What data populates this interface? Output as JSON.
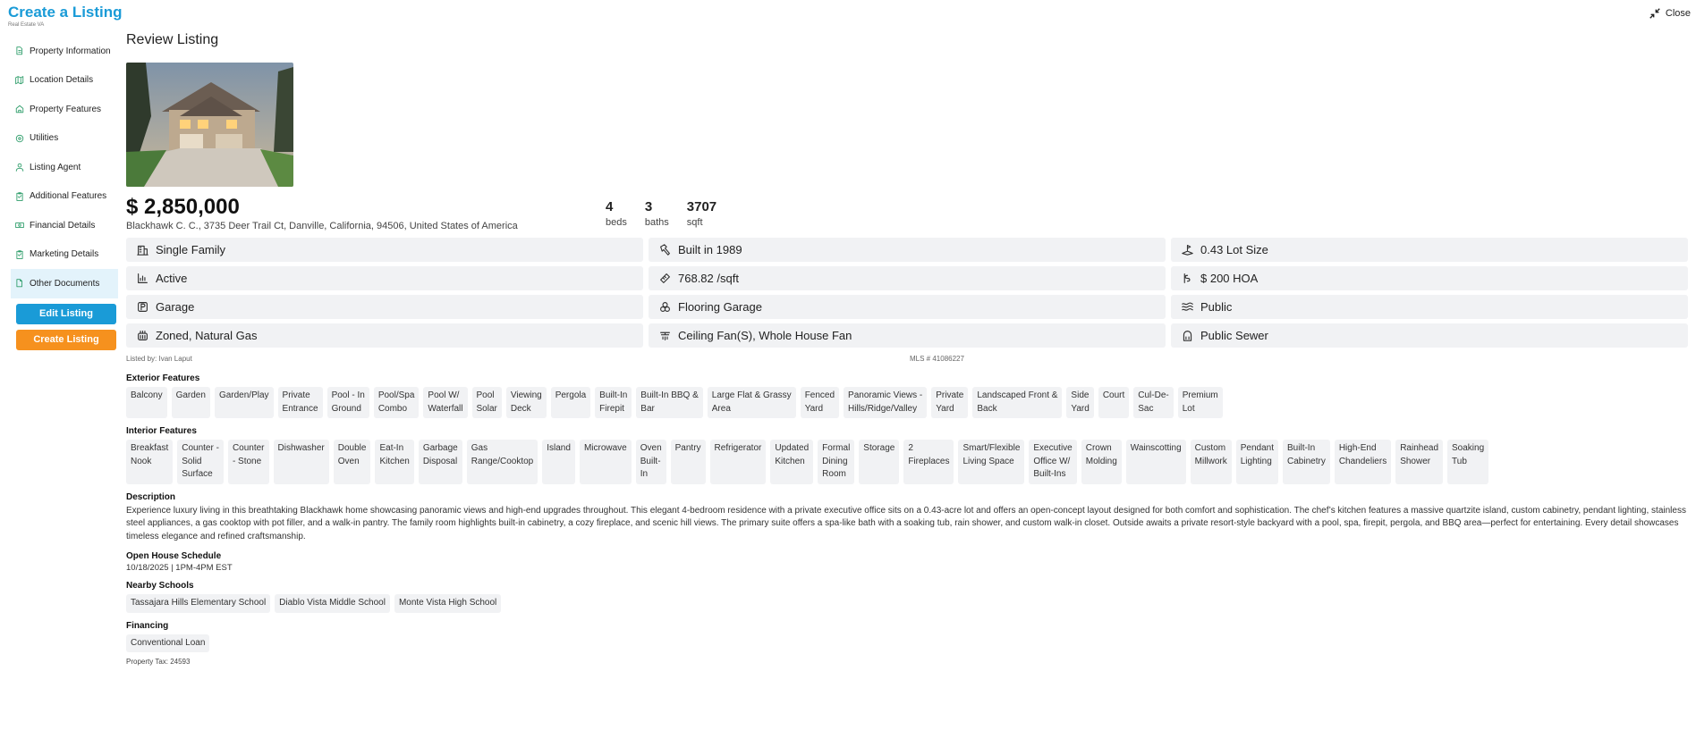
{
  "header": {
    "title": "Create a Listing",
    "subtitle": "Real Estate VA",
    "close_label": "Close"
  },
  "sidebar": {
    "items": [
      {
        "label": "Property Information",
        "icon": "document-icon"
      },
      {
        "label": "Location Details",
        "icon": "map-icon"
      },
      {
        "label": "Property Features",
        "icon": "home-icon"
      },
      {
        "label": "Utilities",
        "icon": "utility-icon"
      },
      {
        "label": "Listing Agent",
        "icon": "user-icon"
      },
      {
        "label": "Additional Features",
        "icon": "clipboard-icon"
      },
      {
        "label": "Financial Details",
        "icon": "money-icon"
      },
      {
        "label": "Marketing Details",
        "icon": "clipboard-icon"
      },
      {
        "label": "Other Documents",
        "icon": "file-icon"
      }
    ],
    "active_index": 8,
    "edit_label": "Edit Listing",
    "create_label": "Create Listing"
  },
  "review": {
    "title": "Review Listing",
    "price": "$ 2,850,000",
    "address": "Blackhawk C. C., 3735 Deer Trail Ct, Danville, California, 94506, United States of America",
    "stats": [
      {
        "num": "4",
        "label": "beds"
      },
      {
        "num": "3",
        "label": "baths"
      },
      {
        "num": "3707",
        "label": "sqft"
      }
    ],
    "facts": [
      {
        "text": "Single Family",
        "icon": "building-icon"
      },
      {
        "text": "Built in 1989",
        "icon": "hammer-icon"
      },
      {
        "text": "0.43 Lot Size",
        "icon": "land-icon"
      },
      {
        "text": "Active",
        "icon": "chart-icon"
      },
      {
        "text": "768.82 /sqft",
        "icon": "ruler-icon"
      },
      {
        "text": "$ 200 HOA",
        "icon": "hoa-icon"
      },
      {
        "text": "Garage",
        "icon": "parking-icon"
      },
      {
        "text": "Flooring Garage",
        "icon": "flooring-icon"
      },
      {
        "text": "Public",
        "icon": "water-icon"
      },
      {
        "text": "Zoned, Natural Gas",
        "icon": "heater-icon"
      },
      {
        "text": "Ceiling Fan(S), Whole House Fan",
        "icon": "fan-icon"
      },
      {
        "text": "Public Sewer",
        "icon": "sewer-icon"
      }
    ],
    "listed_by": "Listed by: Ivan Laput",
    "mls": "MLS # 41086227",
    "exterior_title": "Exterior Features",
    "exterior": [
      "Balcony",
      "Garden",
      "Garden/Play",
      "Private\nEntrance",
      "Pool - In\nGround",
      "Pool/Spa\nCombo",
      "Pool W/\nWaterfall",
      "Pool\nSolar",
      "Viewing\nDeck",
      "Pergola",
      "Built-In\nFirepit",
      "Built-In BBQ &\nBar",
      "Large Flat & Grassy\nArea",
      "Fenced\nYard",
      "Panoramic Views -\nHills/Ridge/Valley",
      "Private\nYard",
      "Landscaped Front &\nBack",
      "Side\nYard",
      "Court",
      "Cul-De-\nSac",
      "Premium\nLot"
    ],
    "interior_title": "Interior Features",
    "interior": [
      "Breakfast\nNook",
      "Counter -\nSolid\nSurface",
      "Counter\n- Stone",
      "Dishwasher",
      "Double\nOven",
      "Eat-In\nKitchen",
      "Garbage\nDisposal",
      "Gas\nRange/Cooktop",
      "Island",
      "Microwave",
      "Oven\nBuilt-\nIn",
      "Pantry",
      "Refrigerator",
      "Updated\nKitchen",
      "Formal\nDining\nRoom",
      "Storage",
      "2\nFireplaces",
      "Smart/Flexible\nLiving Space",
      "Executive\nOffice W/\nBuilt-Ins",
      "Crown\nMolding",
      "Wainscotting",
      "Custom\nMillwork",
      "Pendant\nLighting",
      "Built-In\nCabinetry",
      "High-End\nChandeliers",
      "Rainhead\nShower",
      "Soaking\nTub"
    ],
    "description_title": "Description",
    "description": "Experience luxury living in this breathtaking Blackhawk home showcasing panoramic views and high-end upgrades throughout. This elegant 4-bedroom residence with a private executive office sits on a 0.43-acre lot and offers an open-concept layout designed for both comfort and sophistication. The chef’s kitchen features a massive quartzite island, custom cabinetry, pendant lighting, stainless steel appliances, a gas cooktop with pot filler, and a walk-in pantry. The family room highlights built-in cabinetry, a cozy fireplace, and scenic hill views. The primary suite offers a spa-like bath with a soaking tub, rain shower, and custom walk-in closet. Outside awaits a private resort-style backyard with a pool, spa, firepit, pergola, and BBQ area—perfect for entertaining. Every detail showcases timeless elegance and refined craftsmanship.",
    "open_house_title": "Open House Schedule",
    "open_house": "10/18/2025 | 1PM-4PM EST",
    "schools_title": "Nearby Schools",
    "schools": [
      "Tassajara Hills Elementary School",
      "Diablo Vista Middle School",
      "Monte Vista High School"
    ],
    "financing_title": "Financing",
    "financing": [
      "Conventional Loan"
    ],
    "property_tax": "Property Tax: 24593"
  },
  "colors": {
    "accent": "#1a9bd7",
    "orange": "#f6911e",
    "chip_bg": "#f1f2f4",
    "active_bg": "#e3f3fb",
    "icon_green": "#2e9d6a"
  }
}
